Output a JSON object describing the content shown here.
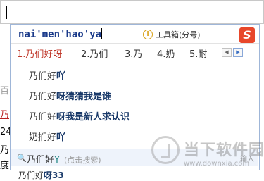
{
  "ime": {
    "pinyin": "nai'men'hao'ya",
    "toolbox_label": "工具箱(分号)",
    "logo_letter": "S",
    "candidates": [
      {
        "index": "1.",
        "text": "乃们好呀"
      },
      {
        "index": "2.",
        "text": "乃们"
      },
      {
        "index": "3.",
        "text": "乃"
      },
      {
        "index": "4.",
        "text": "奶"
      },
      {
        "index": "5.",
        "text": "耐"
      }
    ],
    "pager": {
      "prev": "◀",
      "next": "▶"
    },
    "associations": [
      {
        "prefix": "乃们好",
        "suffix": "吖"
      },
      {
        "prefix": "乃们好",
        "suffix": "呀猜猜我是谁"
      },
      {
        "prefix": "乃们好",
        "suffix": "呀我是新人求认识"
      },
      {
        "prefix": "奶扪好",
        "suffix": "吖"
      }
    ],
    "search": {
      "prefix": "乃们好",
      "suffix": "Y",
      "hint": "(点击搜索)"
    },
    "overflow": {
      "prefix": "乃们好",
      "suffix": "呀33"
    }
  },
  "background": {
    "left_chars": [
      "百",
      "乃",
      "24",
      "乃",
      "度"
    ]
  },
  "watermark": {
    "title": "当下软件园",
    "url": "www.downxia.com",
    "input_label": "输入"
  }
}
